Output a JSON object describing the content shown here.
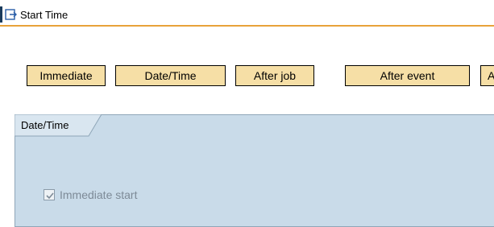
{
  "window": {
    "title": "Start Time"
  },
  "icons": {
    "title_icon": "export-arrow-icon",
    "checkbox": "checkmark-icon"
  },
  "colors": {
    "title_rule": "#e8a23a",
    "button_bg": "#f6dfa6",
    "group_bg": "#c9dbe9",
    "disabled_text": "#7d8a97"
  },
  "toolbar": {
    "buttons": [
      {
        "label": "Immediate"
      },
      {
        "label": "Date/Time"
      },
      {
        "label": "After job"
      },
      {
        "label": "After event"
      },
      {
        "label": "A"
      }
    ]
  },
  "group": {
    "tab_label": "Date/Time",
    "immediate_start": {
      "label": "Immediate start",
      "checked": true,
      "enabled": false
    }
  }
}
